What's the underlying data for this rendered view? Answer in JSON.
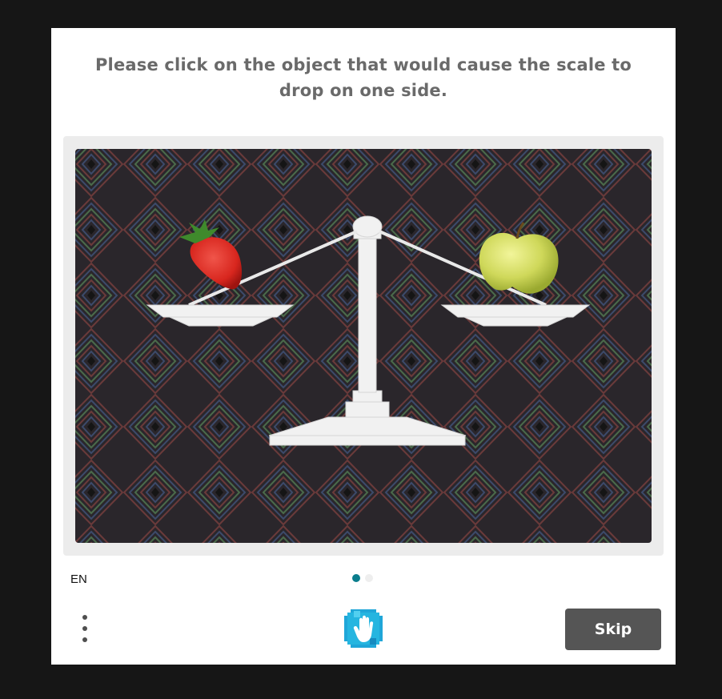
{
  "challenge": {
    "prompt": "Please click on the object that would cause the scale to drop on one side.",
    "image_alt": "strawberry and apple on a balance scale"
  },
  "footer": {
    "language": "EN",
    "skip_label": "Skip",
    "page_indicator": {
      "current": 1,
      "total": 2
    },
    "menu_icon": "vertical-ellipsis-icon",
    "logo_icon": "hand-logo-icon"
  },
  "colors": {
    "accent": "#0a7d8c",
    "skip_bg": "#555555",
    "frame_bg": "#ececec",
    "backdrop": "#161616"
  }
}
